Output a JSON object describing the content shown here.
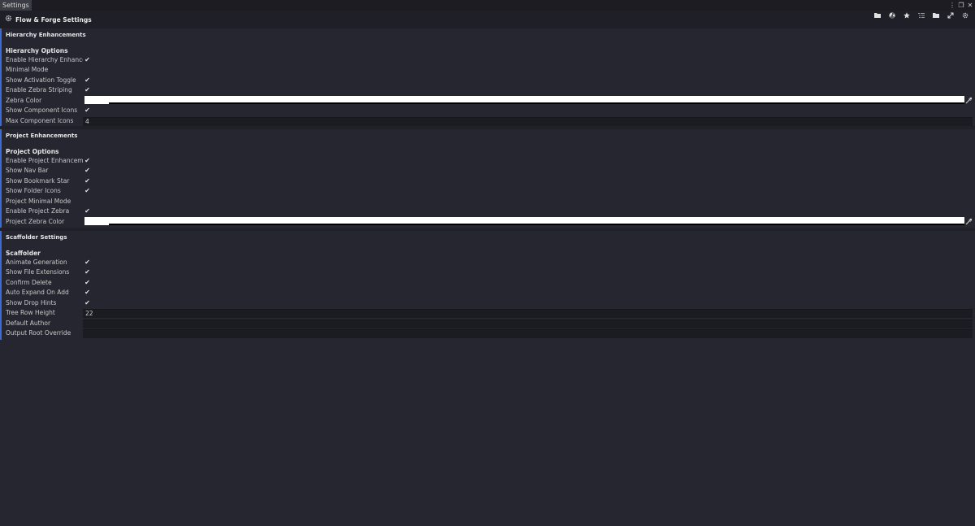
{
  "window": {
    "tab_label": "Settings"
  },
  "header": {
    "title": "Flow & Forge Settings",
    "toolbar_icons": [
      "folder-icon",
      "radiation-icon",
      "star-icon",
      "list-icon",
      "folder-icon",
      "expand-icon",
      "gear-icon"
    ]
  },
  "hierarchy": {
    "section_title": "Hierarchy Enhancements",
    "group_title": "Hierarchy Options",
    "rows": [
      {
        "label": "Enable Hierarchy Enhance",
        "type": "toggle",
        "checked": true
      },
      {
        "label": "Minimal Mode",
        "type": "toggle",
        "checked": false
      },
      {
        "label": "Show Activation Toggle",
        "type": "toggle",
        "checked": true
      },
      {
        "label": "Enable Zebra Striping",
        "type": "toggle",
        "checked": true
      },
      {
        "label": "Zebra Color",
        "type": "color",
        "color": "#ffffff"
      },
      {
        "label": "Show Component Icons",
        "type": "toggle",
        "checked": true
      },
      {
        "label": "Max Component Icons",
        "type": "number",
        "value": "4"
      }
    ]
  },
  "project": {
    "section_title": "Project Enhancements",
    "group_title": "Project Options",
    "rows": [
      {
        "label": "Enable Project Enhanceme",
        "type": "toggle",
        "checked": true
      },
      {
        "label": "Show Nav Bar",
        "type": "toggle",
        "checked": true
      },
      {
        "label": "Show Bookmark Star",
        "type": "toggle",
        "checked": true
      },
      {
        "label": "Show Folder Icons",
        "type": "toggle",
        "checked": true
      },
      {
        "label": "Project Minimal Mode",
        "type": "toggle",
        "checked": false
      },
      {
        "label": "Enable Project Zebra",
        "type": "toggle",
        "checked": true
      },
      {
        "label": "Project Zebra Color",
        "type": "color",
        "color": "#ffffff"
      }
    ]
  },
  "scaffolder": {
    "section_title": "Scaffolder Settings",
    "group_title": "Scaffolder",
    "rows": [
      {
        "label": "Animate Generation",
        "type": "toggle",
        "checked": true
      },
      {
        "label": "Show File Extensions",
        "type": "toggle",
        "checked": true
      },
      {
        "label": "Confirm Delete",
        "type": "toggle",
        "checked": true
      },
      {
        "label": "Auto Expand On Add",
        "type": "toggle",
        "checked": true
      },
      {
        "label": "Show Drop Hints",
        "type": "toggle",
        "checked": true
      },
      {
        "label": "Tree Row Height",
        "type": "number",
        "value": "22"
      },
      {
        "label": "Default Author",
        "type": "text",
        "value": ""
      },
      {
        "label": "Output Root Override",
        "type": "text",
        "value": ""
      }
    ]
  },
  "colors": {
    "accent": "#3d6bd1",
    "background": "#252630"
  }
}
